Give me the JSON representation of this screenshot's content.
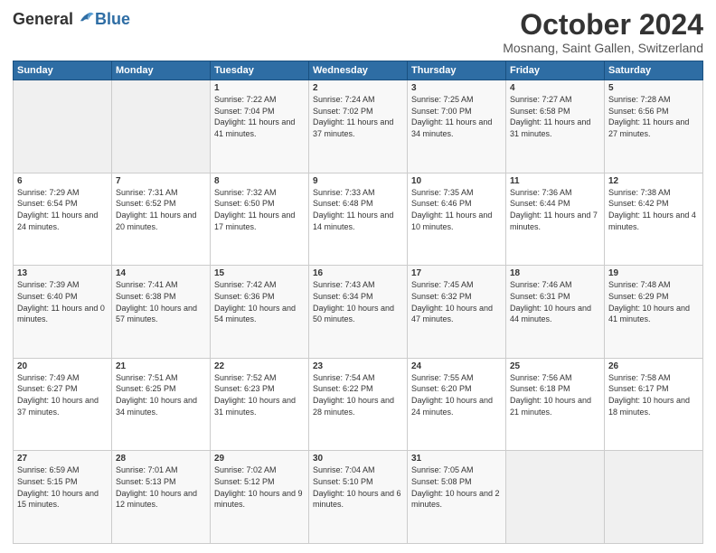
{
  "header": {
    "logo_general": "General",
    "logo_blue": "Blue",
    "month_title": "October 2024",
    "location": "Mosnang, Saint Gallen, Switzerland"
  },
  "weekdays": [
    "Sunday",
    "Monday",
    "Tuesday",
    "Wednesday",
    "Thursday",
    "Friday",
    "Saturday"
  ],
  "weeks": [
    [
      {
        "day": "",
        "empty": true
      },
      {
        "day": "",
        "empty": true
      },
      {
        "day": "1",
        "sunrise": "7:22 AM",
        "sunset": "7:04 PM",
        "daylight": "11 hours and 41 minutes."
      },
      {
        "day": "2",
        "sunrise": "7:24 AM",
        "sunset": "7:02 PM",
        "daylight": "11 hours and 37 minutes."
      },
      {
        "day": "3",
        "sunrise": "7:25 AM",
        "sunset": "7:00 PM",
        "daylight": "11 hours and 34 minutes."
      },
      {
        "day": "4",
        "sunrise": "7:27 AM",
        "sunset": "6:58 PM",
        "daylight": "11 hours and 31 minutes."
      },
      {
        "day": "5",
        "sunrise": "7:28 AM",
        "sunset": "6:56 PM",
        "daylight": "11 hours and 27 minutes."
      }
    ],
    [
      {
        "day": "6",
        "sunrise": "7:29 AM",
        "sunset": "6:54 PM",
        "daylight": "11 hours and 24 minutes."
      },
      {
        "day": "7",
        "sunrise": "7:31 AM",
        "sunset": "6:52 PM",
        "daylight": "11 hours and 20 minutes."
      },
      {
        "day": "8",
        "sunrise": "7:32 AM",
        "sunset": "6:50 PM",
        "daylight": "11 hours and 17 minutes."
      },
      {
        "day": "9",
        "sunrise": "7:33 AM",
        "sunset": "6:48 PM",
        "daylight": "11 hours and 14 minutes."
      },
      {
        "day": "10",
        "sunrise": "7:35 AM",
        "sunset": "6:46 PM",
        "daylight": "11 hours and 10 minutes."
      },
      {
        "day": "11",
        "sunrise": "7:36 AM",
        "sunset": "6:44 PM",
        "daylight": "11 hours and 7 minutes."
      },
      {
        "day": "12",
        "sunrise": "7:38 AM",
        "sunset": "6:42 PM",
        "daylight": "11 hours and 4 minutes."
      }
    ],
    [
      {
        "day": "13",
        "sunrise": "7:39 AM",
        "sunset": "6:40 PM",
        "daylight": "11 hours and 0 minutes."
      },
      {
        "day": "14",
        "sunrise": "7:41 AM",
        "sunset": "6:38 PM",
        "daylight": "10 hours and 57 minutes."
      },
      {
        "day": "15",
        "sunrise": "7:42 AM",
        "sunset": "6:36 PM",
        "daylight": "10 hours and 54 minutes."
      },
      {
        "day": "16",
        "sunrise": "7:43 AM",
        "sunset": "6:34 PM",
        "daylight": "10 hours and 50 minutes."
      },
      {
        "day": "17",
        "sunrise": "7:45 AM",
        "sunset": "6:32 PM",
        "daylight": "10 hours and 47 minutes."
      },
      {
        "day": "18",
        "sunrise": "7:46 AM",
        "sunset": "6:31 PM",
        "daylight": "10 hours and 44 minutes."
      },
      {
        "day": "19",
        "sunrise": "7:48 AM",
        "sunset": "6:29 PM",
        "daylight": "10 hours and 41 minutes."
      }
    ],
    [
      {
        "day": "20",
        "sunrise": "7:49 AM",
        "sunset": "6:27 PM",
        "daylight": "10 hours and 37 minutes."
      },
      {
        "day": "21",
        "sunrise": "7:51 AM",
        "sunset": "6:25 PM",
        "daylight": "10 hours and 34 minutes."
      },
      {
        "day": "22",
        "sunrise": "7:52 AM",
        "sunset": "6:23 PM",
        "daylight": "10 hours and 31 minutes."
      },
      {
        "day": "23",
        "sunrise": "7:54 AM",
        "sunset": "6:22 PM",
        "daylight": "10 hours and 28 minutes."
      },
      {
        "day": "24",
        "sunrise": "7:55 AM",
        "sunset": "6:20 PM",
        "daylight": "10 hours and 24 minutes."
      },
      {
        "day": "25",
        "sunrise": "7:56 AM",
        "sunset": "6:18 PM",
        "daylight": "10 hours and 21 minutes."
      },
      {
        "day": "26",
        "sunrise": "7:58 AM",
        "sunset": "6:17 PM",
        "daylight": "10 hours and 18 minutes."
      }
    ],
    [
      {
        "day": "27",
        "sunrise": "6:59 AM",
        "sunset": "5:15 PM",
        "daylight": "10 hours and 15 minutes."
      },
      {
        "day": "28",
        "sunrise": "7:01 AM",
        "sunset": "5:13 PM",
        "daylight": "10 hours and 12 minutes."
      },
      {
        "day": "29",
        "sunrise": "7:02 AM",
        "sunset": "5:12 PM",
        "daylight": "10 hours and 9 minutes."
      },
      {
        "day": "30",
        "sunrise": "7:04 AM",
        "sunset": "5:10 PM",
        "daylight": "10 hours and 6 minutes."
      },
      {
        "day": "31",
        "sunrise": "7:05 AM",
        "sunset": "5:08 PM",
        "daylight": "10 hours and 2 minutes."
      },
      {
        "day": "",
        "empty": true
      },
      {
        "day": "",
        "empty": true
      }
    ]
  ]
}
